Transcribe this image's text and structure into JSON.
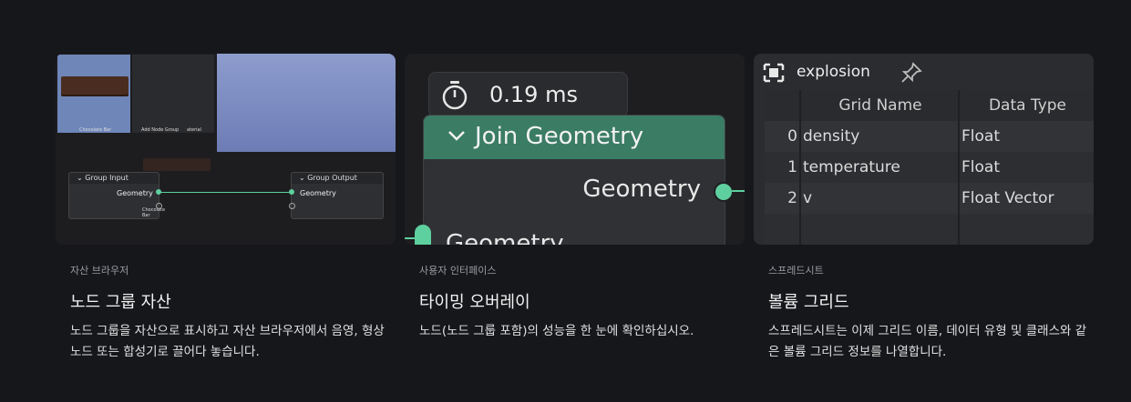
{
  "cards": [
    {
      "category": "자산 브라우저",
      "title": "노드 그룹 자산",
      "description": "노드 그룹을 자산으로 표시하고 자산 브라우저에서 음영, 형상 노드 또는 합성기로 끌어다 놓습니다.",
      "thumb": {
        "chocolate_label": "Chocolate Bar",
        "add_node_group_label": "Add Node Group",
        "material_label": "aterial",
        "group_input": "Group Input",
        "group_output": "Group Output",
        "geometry_left": "Geometry",
        "geometry_right": "Geometry",
        "chocolate_sub": "Chocolate Bar"
      }
    },
    {
      "category": "사용자 인터페이스",
      "title": "타이밍 오버레이",
      "description": "노드(노드 그룹 포함)의 성능을 한 눈에 확인하십시오.",
      "thumb": {
        "timer": "0.19 ms",
        "node_title": "Join Geometry",
        "output_socket": "Geometry",
        "input_socket": "Geometry"
      }
    },
    {
      "category": "스프레드시트",
      "title": "볼륨 그리드",
      "description": "스프레드시트는 이제 그리드 이름, 데이터 유형 및 클래스와 같은 볼륨 그리드 정보를 나열합니다.",
      "thumb": {
        "object_name": "explosion",
        "columns": [
          "Grid Name",
          "Data Type"
        ],
        "rows": [
          {
            "index": "0",
            "name": "density",
            "type": "Float"
          },
          {
            "index": "1",
            "name": "temperature",
            "type": "Float"
          },
          {
            "index": "2",
            "name": "v",
            "type": "Float Vector"
          }
        ]
      }
    }
  ],
  "colors": {
    "background": "#16171b",
    "socket_green": "#5ecf9e",
    "node_header": "#3b7c65"
  }
}
